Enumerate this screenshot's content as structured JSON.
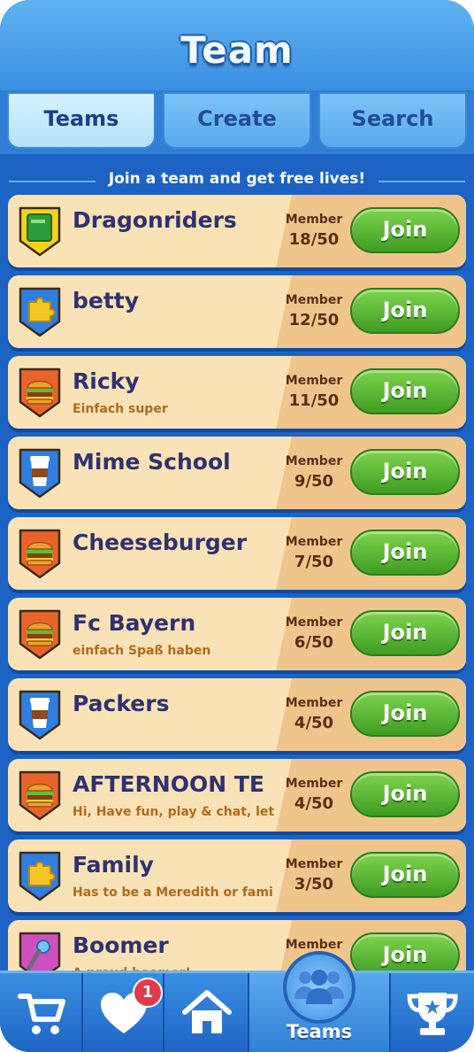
{
  "header": {
    "title": "Team"
  },
  "tabs": [
    {
      "label": "Teams",
      "active": true
    },
    {
      "label": "Create",
      "active": false
    },
    {
      "label": "Search",
      "active": false
    }
  ],
  "subtitle": "Join a team and get free lives!",
  "member_label": "Member",
  "join_label": "Join",
  "teams": [
    {
      "name": "Dragonriders",
      "desc": "",
      "members": "18/50",
      "icon": "book-icon",
      "badge_color": "#f3d21a"
    },
    {
      "name": "betty",
      "desc": "",
      "members": "12/50",
      "icon": "puzzle-icon",
      "badge_color": "#2f7ee0"
    },
    {
      "name": "Ricky",
      "desc": "Einfach super",
      "members": "11/50",
      "icon": "burger-icon",
      "badge_color": "#e8642a"
    },
    {
      "name": "Mime School",
      "desc": "",
      "members": "9/50",
      "icon": "coffee-cup-icon",
      "badge_color": "#2f7ee0"
    },
    {
      "name": "Cheeseburger",
      "desc": "",
      "members": "7/50",
      "icon": "burger-icon",
      "badge_color": "#e8642a"
    },
    {
      "name": "Fc Bayern",
      "desc": "einfach Spaß haben",
      "members": "6/50",
      "icon": "burger-icon",
      "badge_color": "#e8642a"
    },
    {
      "name": "Packers",
      "desc": "",
      "members": "4/50",
      "icon": "coffee-cup-icon",
      "badge_color": "#2f7ee0"
    },
    {
      "name": "AFTERNOON TE",
      "desc": "Hi, Have fun, play & chat,  let",
      "members": "4/50",
      "icon": "burger-icon",
      "badge_color": "#e8642a"
    },
    {
      "name": "Family",
      "desc": "Has to be a Meredith or fami",
      "members": "3/50",
      "icon": "puzzle-icon",
      "badge_color": "#2f7ee0"
    },
    {
      "name": "Boomer",
      "desc": "A proud boomer!",
      "members": "",
      "icon": "microphone-icon",
      "badge_color": "#d04fc0"
    }
  ],
  "nav": {
    "lives_badge": "1",
    "teams_label": "Teams",
    "items": [
      "shop-cart-icon",
      "heart-lives-icon",
      "home-icon",
      "teams-icon",
      "trophy-icon"
    ]
  },
  "colors": {
    "background": "#1c63c4",
    "join_green": "#4caf2a",
    "row_cream": "#f9e3b6"
  }
}
